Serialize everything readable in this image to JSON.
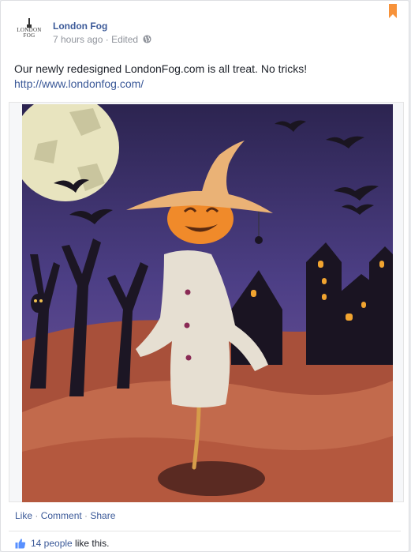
{
  "post": {
    "page_name": "London Fog",
    "timestamp": "7 hours ago",
    "separator": " · ",
    "edited": "Edited",
    "logo_top": "LONDON",
    "logo_bottom": "FOG",
    "text": "Our newly redesigned LondonFog.com is all treat. No tricks!",
    "link": "http://www.londonfog.com/",
    "image_alt": "scarecrow-with-pumpkin-head-illustration"
  },
  "actions": {
    "like": "Like",
    "comment": "Comment",
    "share": "Share",
    "dot": " · "
  },
  "likes": {
    "count_text": "14 people",
    "suffix": " like this."
  },
  "colors": {
    "link": "#3b5998",
    "muted": "#90949c",
    "bookmark": "#f7923a"
  }
}
